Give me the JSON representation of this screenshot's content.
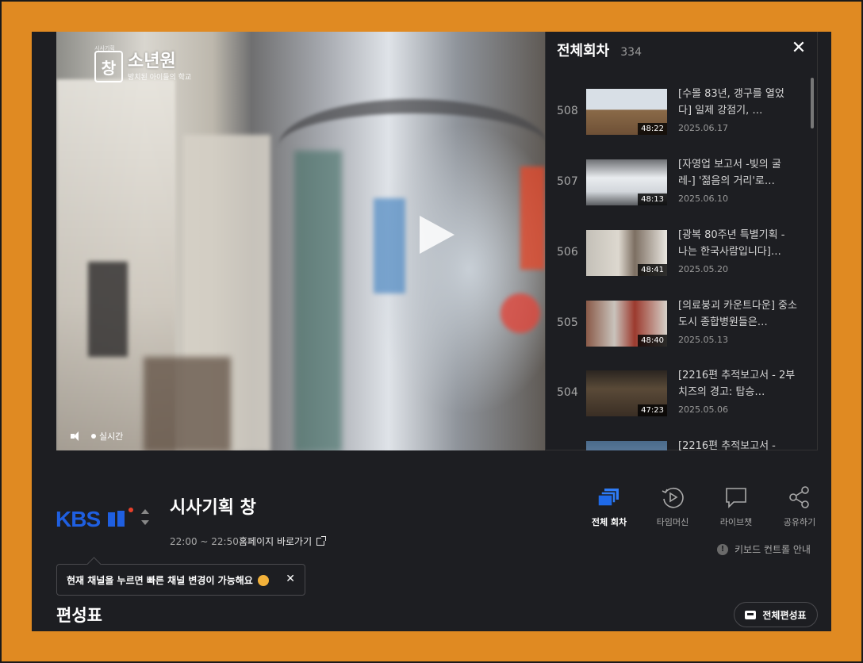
{
  "player": {
    "program_logo_small": "시사기획",
    "program_logo_title": "소년원",
    "program_logo_sub": "방치된 아이들의 학교",
    "live_label": "실시간"
  },
  "episodes_panel": {
    "title": "전체회차",
    "count": "334",
    "items": [
      {
        "number": "508",
        "title": "[수몰 83년, 갱구를 열었다] 일제 강점기, …",
        "date": "2025.06.17",
        "duration": "48:22"
      },
      {
        "number": "507",
        "title": "[자영업 보고서 -빚의 굴레-] '젊음의 거리'로…",
        "date": "2025.06.10",
        "duration": "48:13"
      },
      {
        "number": "506",
        "title": "[광복 80주년 특별기획 - 나는 한국사람입니다]…",
        "date": "2025.05.20",
        "duration": "48:41"
      },
      {
        "number": "505",
        "title": "[의료붕괴 카운트다운] 중소도시 종합병원들은…",
        "date": "2025.05.13",
        "duration": "48:40"
      },
      {
        "number": "504",
        "title": "[2216편 추적보고서 - 2부 치즈의 경고: 탑승…",
        "date": "2025.05.06",
        "duration": "47:23"
      },
      {
        "number": "",
        "title": "[2216편 추적보고서 -",
        "date": "",
        "duration": ""
      }
    ]
  },
  "program": {
    "channel": "KBS1",
    "title": "시사기획 창",
    "time": "22:00 ~ 22:50",
    "homepage_link": "홈페이지 바로가기"
  },
  "actions": [
    {
      "label": "전체 회차",
      "icon": "episodes-icon"
    },
    {
      "label": "타임머신",
      "icon": "timemachine-icon"
    },
    {
      "label": "라이브챗",
      "icon": "chat-icon"
    },
    {
      "label": "공유하기",
      "icon": "share-icon"
    }
  ],
  "keyboard_guide": "키보드 컨트롤 안내",
  "tooltip": {
    "text": "현재 채널을 누르면 빠른 채널 변경이 가능해요"
  },
  "schedule": {
    "heading": "편성표",
    "full_schedule_button": "전체편성표"
  },
  "colors": {
    "background": "#e08a22",
    "app_background": "#1d1e22",
    "kbs_blue": "#1f5fe0",
    "accent_red": "#e8402a"
  }
}
